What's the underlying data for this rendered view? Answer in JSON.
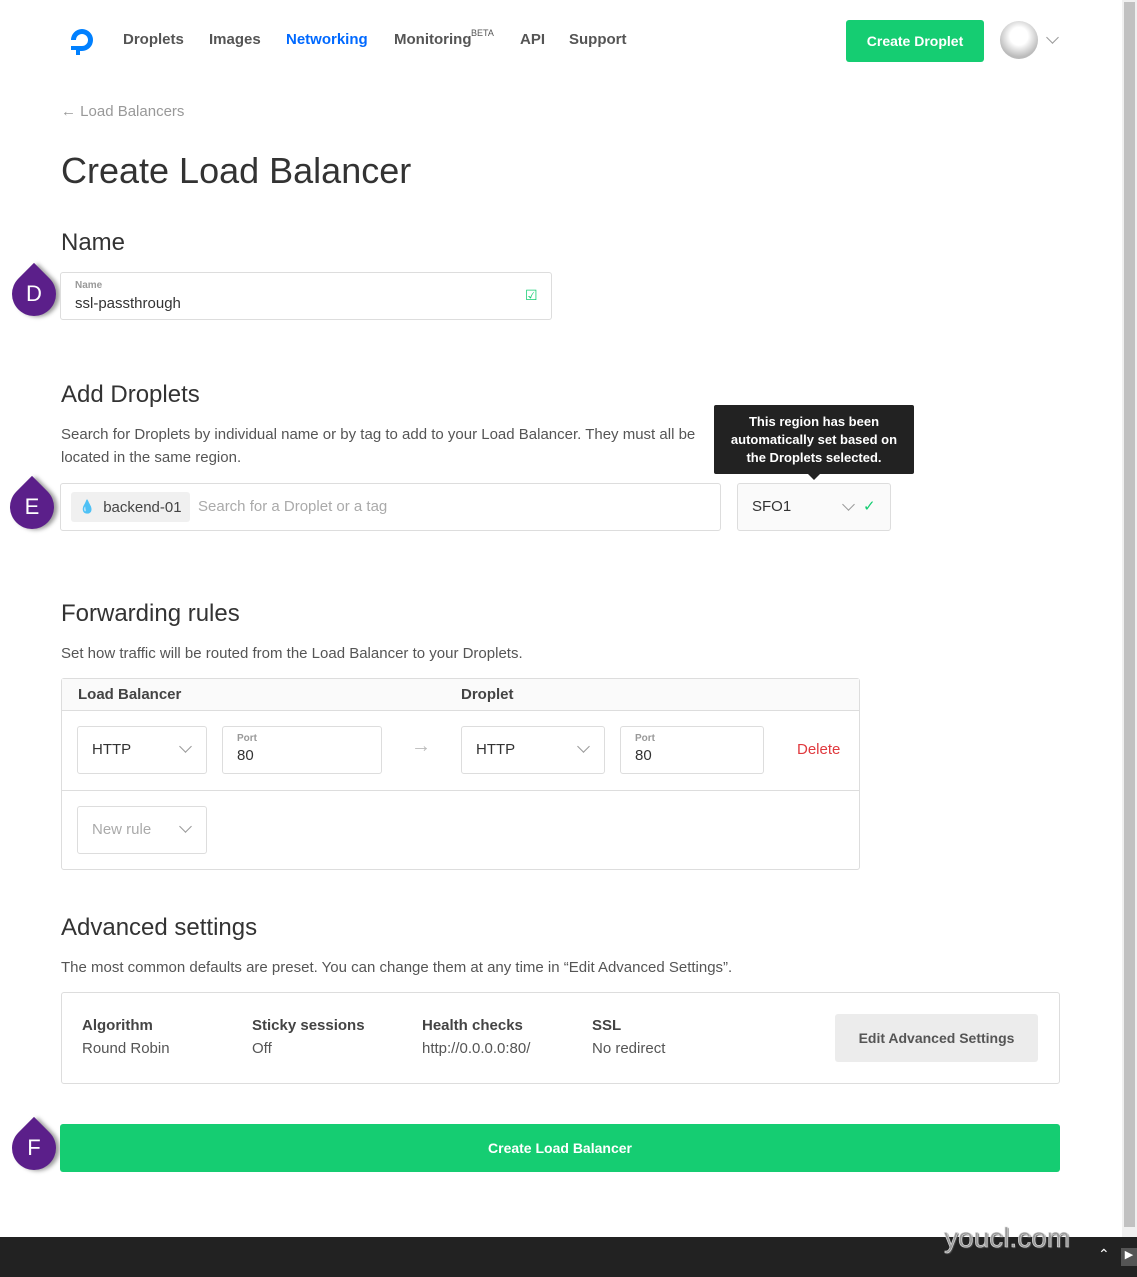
{
  "nav": {
    "items": [
      "Droplets",
      "Images",
      "Networking",
      "Monitoring",
      "API",
      "Support"
    ],
    "beta": "BETA",
    "active": "Networking",
    "create_droplet": "Create Droplet"
  },
  "breadcrumb": "Load Balancers",
  "title": "Create Load Balancer",
  "name_section": {
    "heading": "Name",
    "field_label": "Name",
    "value": "ssl-passthrough",
    "badge": "D"
  },
  "droplets": {
    "heading": "Add Droplets",
    "description": "Search for Droplets by individual name or by tag to add to your Load Balancer. They must all be located in the same region.",
    "tag": "backend-01",
    "placeholder": "Search for a Droplet or a tag",
    "region": "SFO1",
    "tooltip": "This region has been automatically set based on the Droplets selected.",
    "badge": "E"
  },
  "forwarding": {
    "heading": "Forwarding rules",
    "description": "Set how traffic will be routed from the Load Balancer to your Droplets.",
    "col_lb": "Load Balancer",
    "col_droplet": "Droplet",
    "rule": {
      "lb_protocol": "HTTP",
      "port_label": "Port",
      "lb_port": "80",
      "droplet_protocol": "HTTP",
      "droplet_port": "80",
      "delete": "Delete"
    },
    "new_rule": "New rule"
  },
  "advanced": {
    "heading": "Advanced settings",
    "description": "The most common defaults are preset. You can change them at any time in “Edit Advanced Settings”.",
    "items": [
      {
        "label": "Algorithm",
        "value": "Round Robin"
      },
      {
        "label": "Sticky sessions",
        "value": "Off"
      },
      {
        "label": "Health checks",
        "value": "http://0.0.0.0:80/"
      },
      {
        "label": "SSL",
        "value": "No redirect"
      }
    ],
    "edit": "Edit Advanced Settings"
  },
  "submit": {
    "label": "Create Load Balancer",
    "badge": "F"
  },
  "watermark": "youcl.com",
  "colors": {
    "accent": "#0069ff",
    "green": "#15cd72",
    "delete": "#e0393e",
    "badge": "#5b1f8a"
  }
}
